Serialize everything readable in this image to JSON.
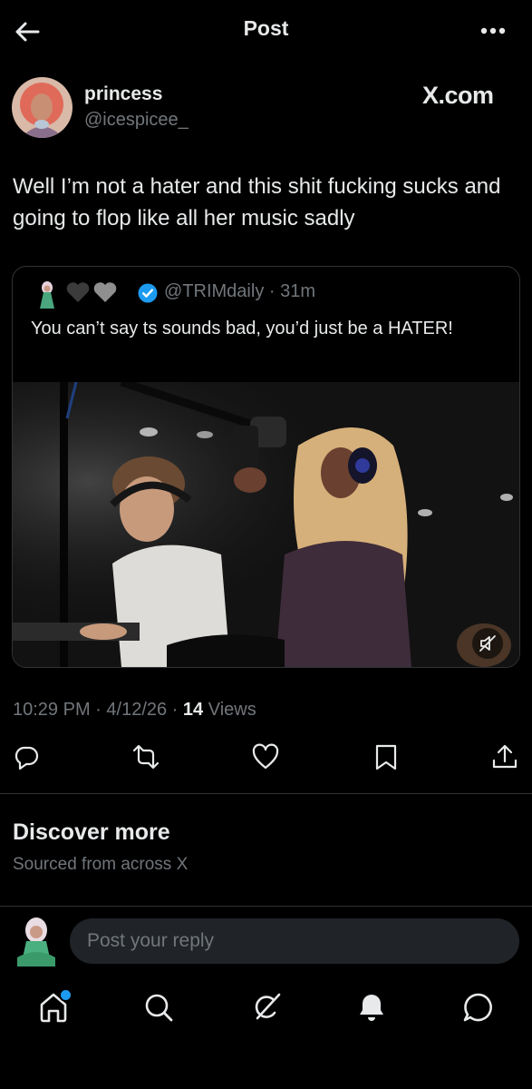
{
  "header": {
    "title": "Post",
    "back_icon": "arrow-left-icon",
    "more_icon": "more-horizontal-icon"
  },
  "post": {
    "author_name": "princess",
    "author_handle": "@icespicee_",
    "badge_text": "X.com",
    "text": "Well I’m not a hater and this shit fucking sucks and going to flop like all her music sadly",
    "time": "10:29 PM",
    "date": "4/12/26",
    "views_count": "14",
    "views_label": "Views"
  },
  "quote": {
    "handle": "@TRIMdaily",
    "time": "31m",
    "text": "You can’t say ts sounds bad, you’d just be a HATER!",
    "verified_color": "#1d9bf0",
    "media_icon": "volume-muted-icon"
  },
  "actions": [
    "reply-icon",
    "repost-icon",
    "like-icon",
    "bookmark-icon",
    "share-icon"
  ],
  "discover": {
    "title": "Discover more",
    "subtitle": "Sourced from across X"
  },
  "reply_box": {
    "placeholder": "Post your reply"
  },
  "bottom_nav": [
    "home-icon",
    "search-icon",
    "grok-icon",
    "notifications-icon",
    "messages-icon"
  ],
  "colors": {
    "background": "#000000",
    "text": "#e7e9ea",
    "muted": "#71767b",
    "border": "#2f3336",
    "accent": "#1d9bf0"
  }
}
